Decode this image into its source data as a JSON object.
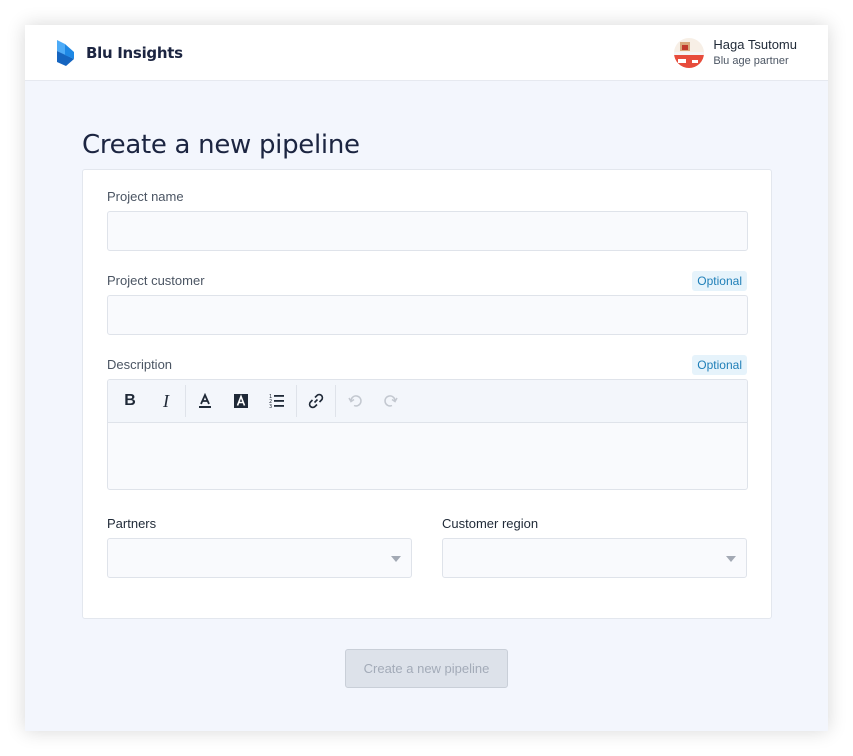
{
  "app": {
    "name": "Blu Insights",
    "brand_color": "#1a73e8"
  },
  "user": {
    "name": "Haga Tsutomu",
    "role": "Blu age partner"
  },
  "page": {
    "title": "Create a new pipeline"
  },
  "form": {
    "project_name": {
      "label": "Project name",
      "value": ""
    },
    "project_customer": {
      "label": "Project customer",
      "badge": "Optional",
      "value": ""
    },
    "description": {
      "label": "Description",
      "badge": "Optional",
      "toolbar": [
        "bold-icon",
        "italic-icon",
        "text-color-icon",
        "highlight-icon",
        "ordered-list-icon",
        "link-icon",
        "undo-icon",
        "redo-icon"
      ],
      "value": ""
    },
    "partners": {
      "label": "Partners",
      "value": ""
    },
    "customer_region": {
      "label": "Customer region",
      "value": ""
    },
    "submit_label": "Create a new pipeline"
  },
  "colors": {
    "badge_bg": "#e6f3fb",
    "badge_text": "#1f7fb8",
    "page_bg": "#f3f6fd",
    "disabled_button": "#dde2ea"
  }
}
